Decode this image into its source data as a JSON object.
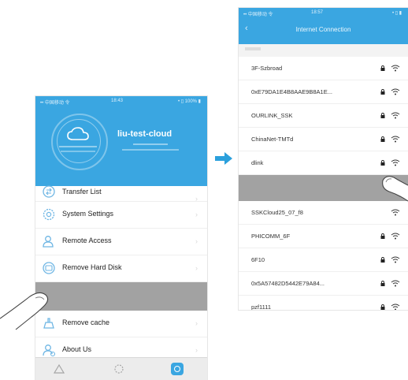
{
  "left_phone": {
    "status": {
      "left": "•• 中国移动 令",
      "center": "18:43",
      "right": "• ▯ 100% ▮"
    },
    "device_name": "liu-test-cloud",
    "menu": [
      {
        "label": "Transfer List",
        "icon": "transfer-icon"
      },
      {
        "label": "System Settings",
        "icon": "gear-icon"
      },
      {
        "label": "Remote Access",
        "icon": "user-icon"
      },
      {
        "label": "Remove Hard Disk",
        "icon": "disk-icon"
      },
      {
        "label": "Remove cache",
        "icon": "broom-icon"
      },
      {
        "label": "About Us",
        "icon": "user-info-icon"
      }
    ],
    "chevron": "›",
    "tabbar": [
      "cloud-tab-icon",
      "storage-tab-icon",
      "settings-tab-icon"
    ]
  },
  "right_phone": {
    "status": {
      "left": "•• 中国移动 令",
      "center": "18:57",
      "right": "• ▯ ▮"
    },
    "back": "‹",
    "title": "Internet Connection",
    "networks_top": [
      {
        "ssid": "3F-Szbroad",
        "secured": true
      },
      {
        "ssid": "0xE79DA1E4B8AAE9B8A1E...",
        "secured": true
      },
      {
        "ssid": "OURLINK_SSK",
        "secured": true
      },
      {
        "ssid": "ChinaNet-TMTd",
        "secured": true
      },
      {
        "ssid": "dlink",
        "secured": true
      }
    ],
    "networks_bottom": [
      {
        "ssid": "SSKCloud25_07_f8",
        "secured": false
      },
      {
        "ssid": "PHICOMM_6F",
        "secured": true
      },
      {
        "ssid": "6F10",
        "secured": true
      },
      {
        "ssid": "0x5A57482D5442E79A84...",
        "secured": true
      },
      {
        "ssid": "pzf1111",
        "secured": true
      }
    ]
  },
  "colors": {
    "accent": "#3aa6e1",
    "highlight": "#a2a2a2",
    "arrow": "#2ba0dc"
  }
}
